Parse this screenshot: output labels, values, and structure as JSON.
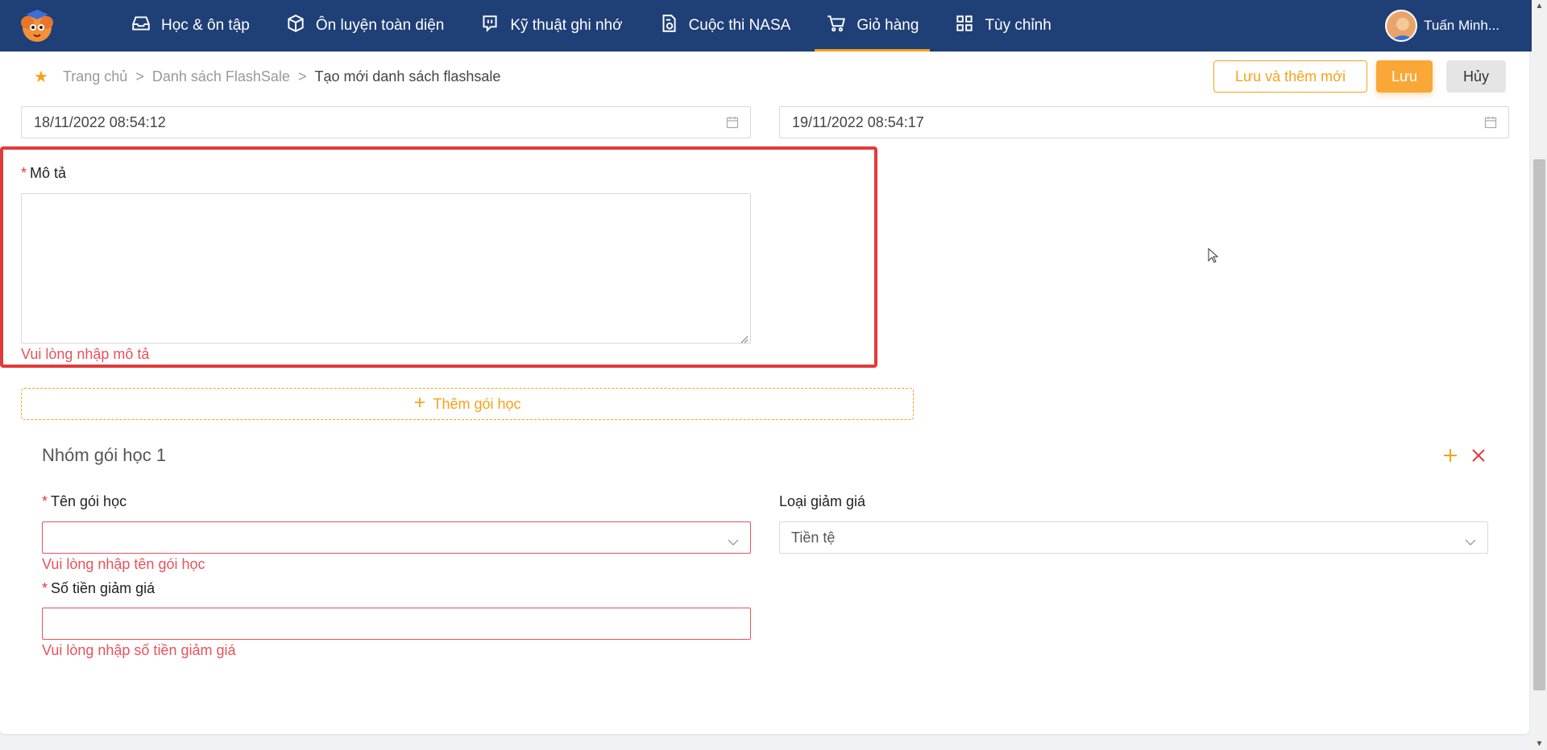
{
  "nav": {
    "items": [
      {
        "label": "Học & ôn tập",
        "icon": "inbox-icon"
      },
      {
        "label": "Ôn luyện toàn diện",
        "icon": "box-icon"
      },
      {
        "label": "Kỹ thuật ghi nhớ",
        "icon": "chat-bubble-icon"
      },
      {
        "label": "Cuộc thi NASA",
        "icon": "document-clock-icon"
      },
      {
        "label": "Giỏ hàng",
        "icon": "cart-icon",
        "active": true
      },
      {
        "label": "Tùy chỉnh",
        "icon": "grid-icon"
      }
    ],
    "user_name": "Tuấn Minh..."
  },
  "breadcrumb": {
    "home": "Trang chủ",
    "sep": ">",
    "list": "Danh sách FlashSale",
    "current": "Tạo mới danh sách flashsale"
  },
  "actions": {
    "save_new": "Lưu và thêm mới",
    "save": "Lưu",
    "cancel": "Hủy"
  },
  "dates": {
    "start": "18/11/2022 08:54:12",
    "end": "19/11/2022 08:54:17"
  },
  "description": {
    "required_mark": "*",
    "label": "Mô tả",
    "value": "",
    "error": "Vui lòng nhập mô tả"
  },
  "add_package_label": "Thêm gói học",
  "group": {
    "title": "Nhóm gói học 1",
    "package_name_label": "Tên gói học",
    "package_name_value": "",
    "package_name_error": "Vui lòng nhập tên gói học",
    "discount_type_label": "Loại giảm giá",
    "discount_type_value": "Tiền tệ",
    "discount_amount_label": "Số tiền giảm giá",
    "discount_amount_value": "",
    "discount_amount_error": "Vui lòng nhập số tiền giảm giá"
  },
  "colors": {
    "nav_bg": "#1f3f77",
    "accent": "#f7a11a",
    "error": "#e8525a",
    "highlight": "#e23a3a"
  }
}
